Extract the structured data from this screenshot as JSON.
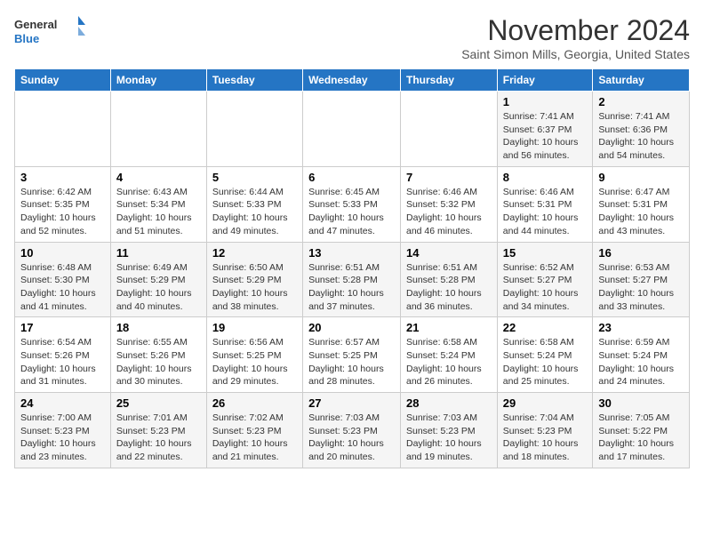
{
  "header": {
    "logo_line1": "General",
    "logo_line2": "Blue",
    "month": "November 2024",
    "location": "Saint Simon Mills, Georgia, United States"
  },
  "days_of_week": [
    "Sunday",
    "Monday",
    "Tuesday",
    "Wednesday",
    "Thursday",
    "Friday",
    "Saturday"
  ],
  "weeks": [
    [
      {
        "day": "",
        "info": ""
      },
      {
        "day": "",
        "info": ""
      },
      {
        "day": "",
        "info": ""
      },
      {
        "day": "",
        "info": ""
      },
      {
        "day": "",
        "info": ""
      },
      {
        "day": "1",
        "info": "Sunrise: 7:41 AM\nSunset: 6:37 PM\nDaylight: 10 hours and 56 minutes."
      },
      {
        "day": "2",
        "info": "Sunrise: 7:41 AM\nSunset: 6:36 PM\nDaylight: 10 hours and 54 minutes."
      }
    ],
    [
      {
        "day": "3",
        "info": "Sunrise: 6:42 AM\nSunset: 5:35 PM\nDaylight: 10 hours and 52 minutes."
      },
      {
        "day": "4",
        "info": "Sunrise: 6:43 AM\nSunset: 5:34 PM\nDaylight: 10 hours and 51 minutes."
      },
      {
        "day": "5",
        "info": "Sunrise: 6:44 AM\nSunset: 5:33 PM\nDaylight: 10 hours and 49 minutes."
      },
      {
        "day": "6",
        "info": "Sunrise: 6:45 AM\nSunset: 5:33 PM\nDaylight: 10 hours and 47 minutes."
      },
      {
        "day": "7",
        "info": "Sunrise: 6:46 AM\nSunset: 5:32 PM\nDaylight: 10 hours and 46 minutes."
      },
      {
        "day": "8",
        "info": "Sunrise: 6:46 AM\nSunset: 5:31 PM\nDaylight: 10 hours and 44 minutes."
      },
      {
        "day": "9",
        "info": "Sunrise: 6:47 AM\nSunset: 5:31 PM\nDaylight: 10 hours and 43 minutes."
      }
    ],
    [
      {
        "day": "10",
        "info": "Sunrise: 6:48 AM\nSunset: 5:30 PM\nDaylight: 10 hours and 41 minutes."
      },
      {
        "day": "11",
        "info": "Sunrise: 6:49 AM\nSunset: 5:29 PM\nDaylight: 10 hours and 40 minutes."
      },
      {
        "day": "12",
        "info": "Sunrise: 6:50 AM\nSunset: 5:29 PM\nDaylight: 10 hours and 38 minutes."
      },
      {
        "day": "13",
        "info": "Sunrise: 6:51 AM\nSunset: 5:28 PM\nDaylight: 10 hours and 37 minutes."
      },
      {
        "day": "14",
        "info": "Sunrise: 6:51 AM\nSunset: 5:28 PM\nDaylight: 10 hours and 36 minutes."
      },
      {
        "day": "15",
        "info": "Sunrise: 6:52 AM\nSunset: 5:27 PM\nDaylight: 10 hours and 34 minutes."
      },
      {
        "day": "16",
        "info": "Sunrise: 6:53 AM\nSunset: 5:27 PM\nDaylight: 10 hours and 33 minutes."
      }
    ],
    [
      {
        "day": "17",
        "info": "Sunrise: 6:54 AM\nSunset: 5:26 PM\nDaylight: 10 hours and 31 minutes."
      },
      {
        "day": "18",
        "info": "Sunrise: 6:55 AM\nSunset: 5:26 PM\nDaylight: 10 hours and 30 minutes."
      },
      {
        "day": "19",
        "info": "Sunrise: 6:56 AM\nSunset: 5:25 PM\nDaylight: 10 hours and 29 minutes."
      },
      {
        "day": "20",
        "info": "Sunrise: 6:57 AM\nSunset: 5:25 PM\nDaylight: 10 hours and 28 minutes."
      },
      {
        "day": "21",
        "info": "Sunrise: 6:58 AM\nSunset: 5:24 PM\nDaylight: 10 hours and 26 minutes."
      },
      {
        "day": "22",
        "info": "Sunrise: 6:58 AM\nSunset: 5:24 PM\nDaylight: 10 hours and 25 minutes."
      },
      {
        "day": "23",
        "info": "Sunrise: 6:59 AM\nSunset: 5:24 PM\nDaylight: 10 hours and 24 minutes."
      }
    ],
    [
      {
        "day": "24",
        "info": "Sunrise: 7:00 AM\nSunset: 5:23 PM\nDaylight: 10 hours and 23 minutes."
      },
      {
        "day": "25",
        "info": "Sunrise: 7:01 AM\nSunset: 5:23 PM\nDaylight: 10 hours and 22 minutes."
      },
      {
        "day": "26",
        "info": "Sunrise: 7:02 AM\nSunset: 5:23 PM\nDaylight: 10 hours and 21 minutes."
      },
      {
        "day": "27",
        "info": "Sunrise: 7:03 AM\nSunset: 5:23 PM\nDaylight: 10 hours and 20 minutes."
      },
      {
        "day": "28",
        "info": "Sunrise: 7:03 AM\nSunset: 5:23 PM\nDaylight: 10 hours and 19 minutes."
      },
      {
        "day": "29",
        "info": "Sunrise: 7:04 AM\nSunset: 5:23 PM\nDaylight: 10 hours and 18 minutes."
      },
      {
        "day": "30",
        "info": "Sunrise: 7:05 AM\nSunset: 5:22 PM\nDaylight: 10 hours and 17 minutes."
      }
    ]
  ]
}
